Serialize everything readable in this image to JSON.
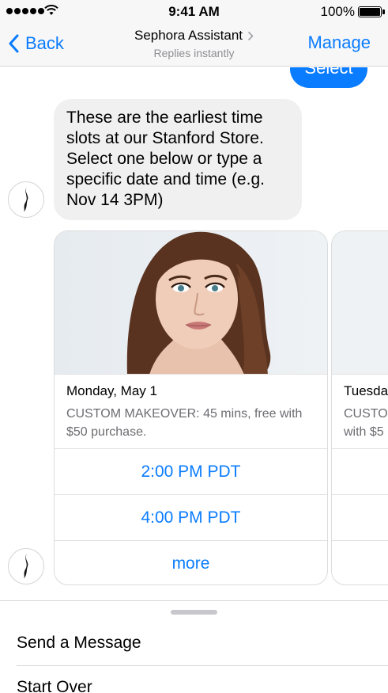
{
  "status_bar": {
    "time": "9:41 AM",
    "battery": "100%"
  },
  "nav": {
    "back_label": "Back",
    "title": "Sephora Assistant",
    "subtitle": "Replies instantly",
    "manage_label": "Manage"
  },
  "chat": {
    "select_bubble": "Select",
    "bot_message": "These are the earliest time slots at our Stanford Store. Select one below or type a specific date and time (e.g. Nov 14 3PM)",
    "cards": [
      {
        "title": "Monday, May 1",
        "subtitle": "CUSTOM MAKEOVER: 45 mins, free with $50 purchase.",
        "buttons": [
          "2:00 PM PDT",
          "4:00 PM PDT",
          "more"
        ]
      },
      {
        "title": "Tuesda",
        "subtitle_lines": [
          "CUSTO",
          "with $5"
        ]
      }
    ]
  },
  "menu": {
    "send_message": "Send a Message",
    "start_over": "Start Over"
  },
  "colors": {
    "accent": "#0a7cff",
    "bubble_gray": "#f1f0f0",
    "secondary_text": "#6d6d72"
  }
}
